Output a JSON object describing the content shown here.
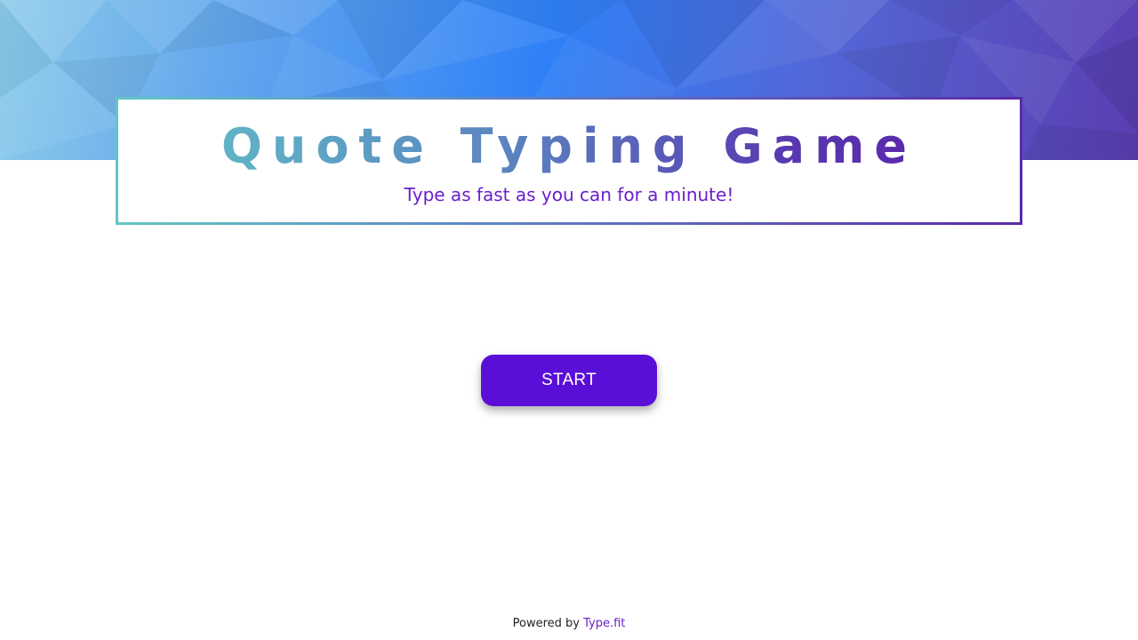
{
  "header": {
    "title": "Quote Typing Game",
    "subtitle": "Type as fast as you can for a minute!"
  },
  "main": {
    "start_label": "START"
  },
  "footer": {
    "prefix": "Powered by ",
    "link_label": "Type.fit"
  },
  "colors": {
    "accent": "#5a0fd8",
    "subtitle": "#6a1fc9",
    "banner_blue": "#2f80f7",
    "banner_purple": "#5a3db1"
  }
}
